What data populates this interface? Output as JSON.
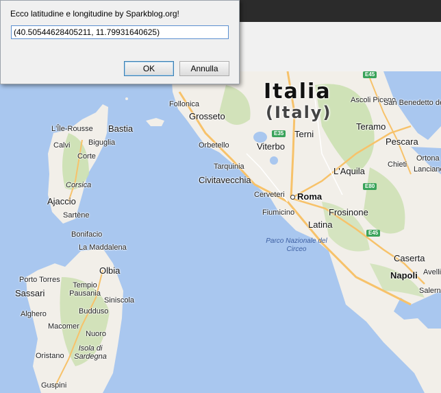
{
  "dialog": {
    "message": "Ecco latitudine e longitudine by Sparkblog.org!",
    "input_value": "(40.50544628405211, 11.79931640625)",
    "ok_label": "OK",
    "cancel_label": "Annulla"
  },
  "map": {
    "country_name": "Italia",
    "country_name_en": "(Italy)",
    "places": [
      "Follonica",
      "Grosseto",
      "Orbetello",
      "Viterbo",
      "Terni",
      "Tarquinia",
      "Civitavecchia",
      "Cerveteri",
      "Roma",
      "Fiumicino",
      "Latina",
      "Frosinone",
      "L'Aquila",
      "Teramo",
      "Ascoli Piceno",
      "San Benedetto del Tronto",
      "Pescara",
      "Chieti",
      "Ortona",
      "Lanciano",
      "Caserta",
      "Napoli",
      "Avellino",
      "Salerno",
      "L'Île-Rousse",
      "Bastia",
      "Calvi",
      "Biguglia",
      "Corte",
      "Corsica",
      "Ajaccio",
      "Sartène",
      "Bonifacio",
      "La Maddalena",
      "Olbia",
      "Porto Torres",
      "Tempio Pausania",
      "Sassari",
      "Siniscola",
      "Alghero",
      "Budduso",
      "Macomer",
      "Nuoro",
      "Isola di Sardegna",
      "Oristano",
      "Guspini"
    ],
    "park_label": "Parco Nazionale del Circeo",
    "highways": [
      "E45",
      "E35",
      "E80",
      "E45"
    ],
    "colors": {
      "sea": "#a9c7ef",
      "land": "#f2efe9",
      "forest": "#c9dfae",
      "road": "#f7c26a"
    }
  }
}
